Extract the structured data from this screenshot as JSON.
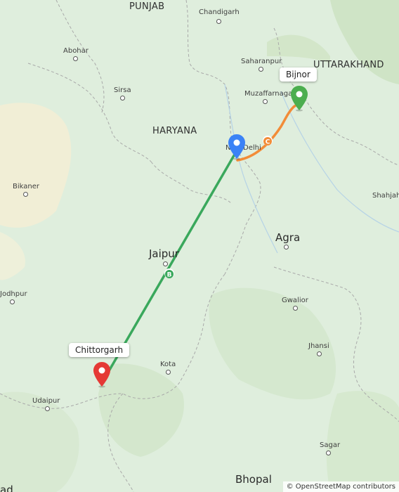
{
  "map": {
    "attribution": "© OpenStreetMap contributors",
    "colors": {
      "land": "#dfeedd",
      "desert": "#f2efd8",
      "forest": "#cde3c4",
      "border": "#a7a7a7",
      "route_green": "#3aa85c",
      "route_orange": "#f28c38",
      "marker_red": "#e53935",
      "marker_green": "#4cae4f",
      "marker_blue": "#3b82f6"
    },
    "states": {
      "punjab": "PUNJAB",
      "haryana": "HARYANA",
      "uttarakhand": "UTTARAKHAND"
    },
    "cities": {
      "chandigarh": "Chandigarh",
      "abohar": "Abohar",
      "sirsa": "Sirsa",
      "saharanpur": "Saharanpur",
      "muzaffarnagar": "Muzaffarnagar",
      "new_delhi": "New Delhi",
      "bikaner": "Bikaner",
      "shahjahanpur": "Shahjahanpur",
      "agra": "Agra",
      "jaipur": "Jaipur",
      "jodhpur": "Jodhpur",
      "gwalior": "Gwalior",
      "jhansi": "Jhansi",
      "kota": "Kota",
      "udaipur": "Udaipur",
      "sagar": "Sagar",
      "bhopal": "Bhopal",
      "ahmedabad_partial": "ad"
    },
    "callouts": {
      "bijnor": "Bijnor",
      "chittorgarh": "Chittorgarh"
    },
    "route_badges": {
      "green_segment": "B",
      "orange_segment": "C"
    },
    "markers": {
      "start": "red-pin-icon",
      "waypoint": "blue-pin-icon",
      "end": "green-pin-icon"
    }
  }
}
